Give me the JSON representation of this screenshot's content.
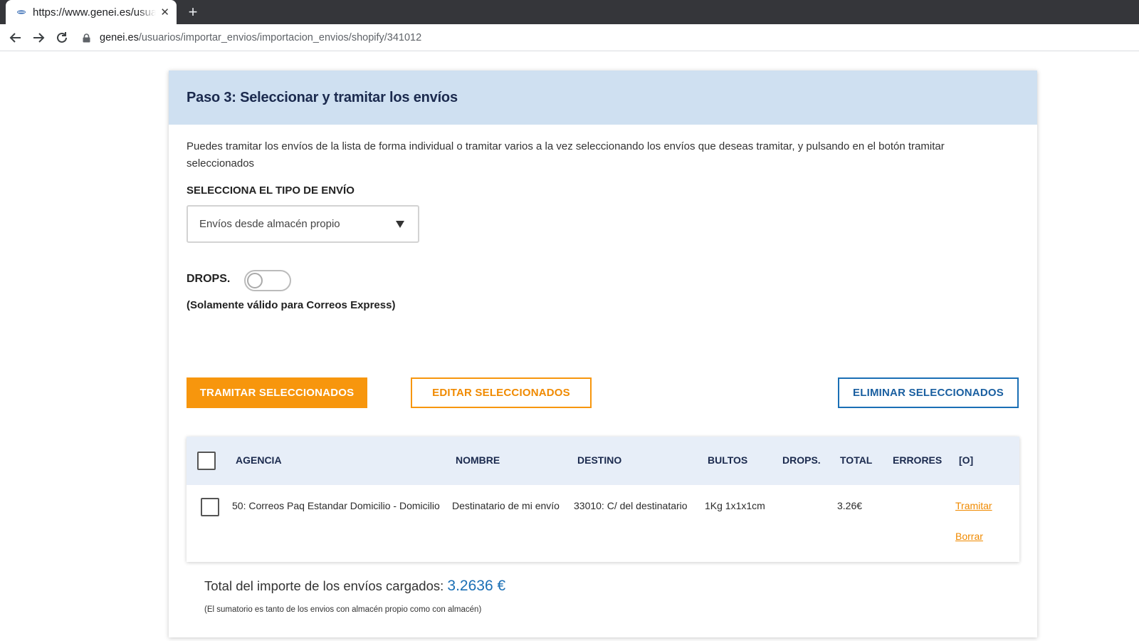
{
  "browser": {
    "tab_title": "https://www.genei.es/usuarios/importar_envios",
    "new_tab_label": "+",
    "close_label": "✕",
    "url_host": "genei.es",
    "url_path": "/usuarios/importar_envios/importacion_envios/shopify/341012"
  },
  "page": {
    "title": "Paso 3: Seleccionar y tramitar los envíos",
    "intro": "Puedes tramitar los envíos de la lista de forma individual o tramitar varios a la vez seleccionando los envíos que deseas tramitar, y pulsando en el botón tramitar seleccionados",
    "shipping_type_label": "SELECCIONA EL TIPO DE ENVÍO",
    "shipping_type_value": "Envíos desde almacén propio",
    "drops_label": "DROPS.",
    "drops_enabled": false,
    "drops_note": "(Solamente válido para Correos Express)"
  },
  "actions": {
    "process_selected": "TRAMITAR SELECCIONADOS",
    "edit_selected": "EDITAR SELECCIONADOS",
    "delete_selected": "ELIMINAR SELECCIONADOS"
  },
  "table": {
    "headers": {
      "agency": "AGENCIA",
      "name": "NOMBRE",
      "destination": "DESTINO",
      "packages": "BULTOS",
      "drops": "DROPS.",
      "total": "TOTAL",
      "errors": "ERRORES",
      "options": "[O]"
    },
    "rows": [
      {
        "agency": "50: Correos Paq Estandar Domicilio - Domicilio",
        "name": "Destinatario de mi envío",
        "destination": "33010: C/ del destinatario",
        "packages": "1Kg 1x1x1cm",
        "drops": "",
        "total": "3.26€",
        "errors": "",
        "action_process": "Tramitar",
        "action_delete": "Borrar"
      }
    ]
  },
  "summary": {
    "label": "Total del importe de los envíos cargados:",
    "amount": "3.2636 €",
    "note": "(El sumatorio es tanto de los envios con almacén propio como con almacén)"
  },
  "colors": {
    "accent_orange": "#f7960d",
    "accent_blue": "#1a6fb5",
    "header_bg": "#cfe0f1"
  }
}
